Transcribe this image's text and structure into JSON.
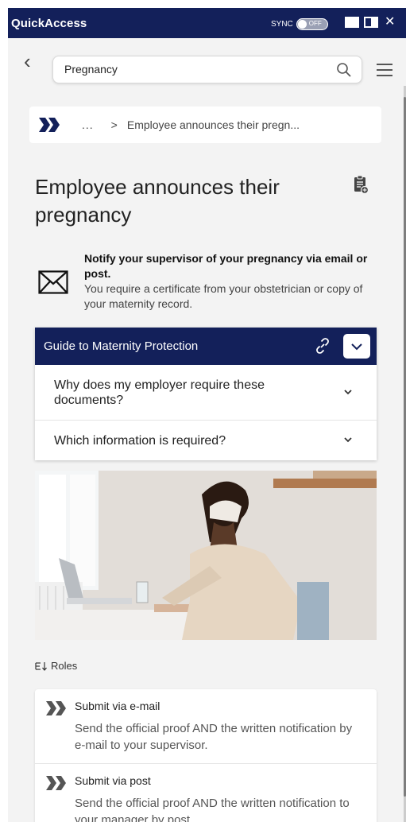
{
  "app": {
    "title": "QuickAccess",
    "sync_label": "SYNC",
    "sync_state": "OFF"
  },
  "search": {
    "value": "Pregnancy"
  },
  "breadcrumb": {
    "ellipsis": "...",
    "separator": ">",
    "current": "Employee announces their pregn..."
  },
  "page": {
    "title": "Employee announces their pregnancy"
  },
  "notify": {
    "headline": "Notify your supervisor of your pregnancy via email or post.",
    "detail": "You require a certificate from your obstetrician or copy of your maternity record."
  },
  "guide": {
    "title": "Guide to Maternity Protection",
    "questions": [
      {
        "label": "Why does my employer require these documents?"
      },
      {
        "label": "Which information is required?"
      }
    ]
  },
  "roles": {
    "label": "Roles",
    "items": [
      {
        "title": "Submit via e-mail",
        "desc": "Send the official proof AND the written notification by e-mail to your supervisor."
      },
      {
        "title": "Submit via post",
        "desc": "Send the official proof AND the written notification to your manager by post."
      }
    ]
  },
  "colors": {
    "navy": "#13205a",
    "background": "#f3f3f3"
  }
}
